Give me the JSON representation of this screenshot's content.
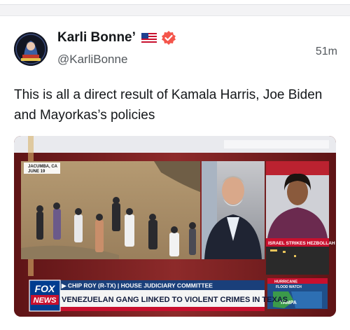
{
  "post": {
    "author_name": "Karli Bonne’",
    "author_handle": "@KarliBonne",
    "timestamp": "51m",
    "text": "This is all a direct result of Kamala Harris, Joe Biden and Mayorkas’s policies",
    "icons": {
      "flag": "us-flag-icon",
      "verified": "verified-badge-icon"
    }
  },
  "video": {
    "location_tag_line1": "JACUMBA, CA",
    "location_tag_line2": "JUNE 19",
    "network_line1": "FOX",
    "network_line2": "NEWS",
    "lower_third_name": "▶ CHIP ROY (R-TX) | HOUSE JUDICIARY COMMITTEE",
    "headline": "VENEZUELAN GANG LINKED TO VIOLENT CRIMES IN TEXAS",
    "side_ticker": "ISRAEL STRIKES HEZBOLLAH",
    "weather_label": "HURRICANE",
    "weather_sub": "FLOOD WATCH",
    "weather_city": "TAMPA"
  },
  "colors": {
    "verified": "#f4554b",
    "fox_blue": "#003c8f",
    "ticker_red": "#c8102e"
  }
}
